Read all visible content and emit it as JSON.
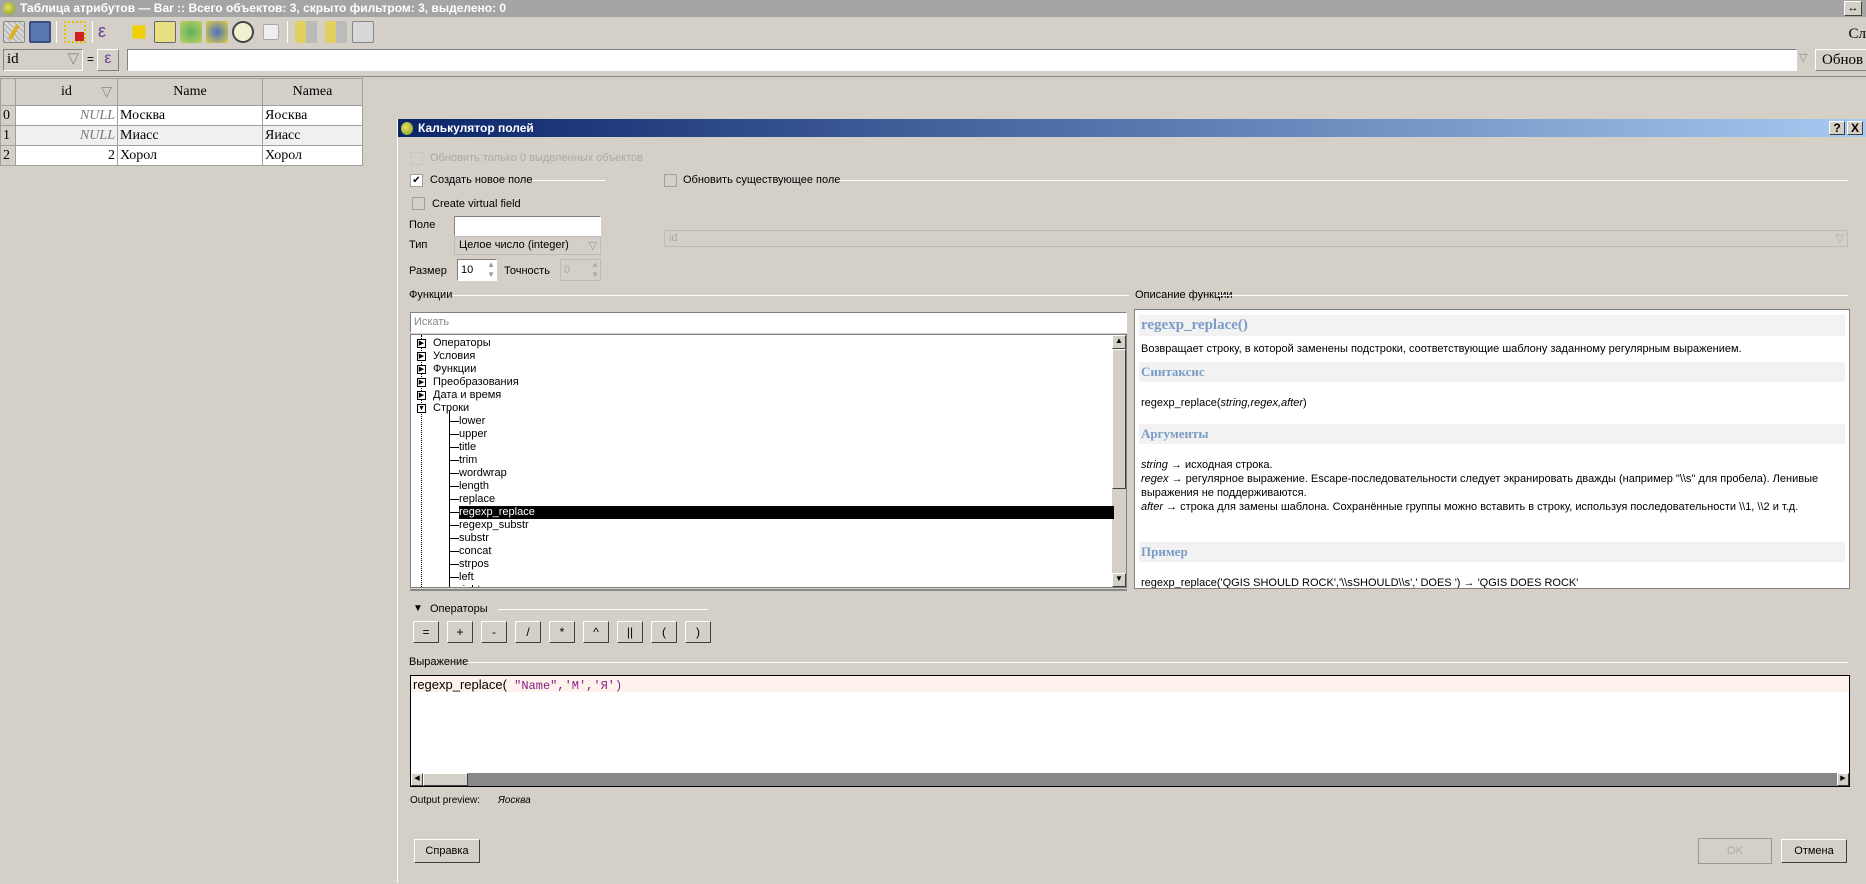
{
  "window": {
    "title": "Таблица атрибутов — Bar :: Всего объектов: 3, скрыто фильтром: 3, выделено: 0",
    "restore_icon": "↔",
    "corner_text": "Сл"
  },
  "toolbar": {
    "icons": [
      "edit-pencil-icon",
      "save-edits-icon",
      "delete-selected-icon",
      "select-by-expression-icon",
      "invert-selection-icon",
      "move-selection-to-top-icon",
      "pan-to-selected-icon",
      "zoom-to-selected-icon",
      "copy-rows-icon",
      "delete-column-icon",
      "new-column-icon",
      "field-calculator-icon"
    ]
  },
  "filter": {
    "field": "id",
    "equals": "=",
    "epsilon": "ε",
    "value": "",
    "update_button": "Обнов"
  },
  "table": {
    "columns": [
      "id",
      "Name",
      "Namea"
    ],
    "rows": [
      {
        "n": "0",
        "id": "NULL",
        "name": "Москва",
        "namea": "Яосква"
      },
      {
        "n": "1",
        "id": "NULL",
        "name": "Миасс",
        "namea": "Яиасс"
      },
      {
        "n": "2",
        "id": "2",
        "name": "Хорол",
        "namea": "Хорол"
      }
    ]
  },
  "dialog": {
    "title": "Калькулятор полей",
    "help_icon": "?",
    "close_icon": "X",
    "update_selected": "Обновить только 0 выделенных объектов",
    "create_new": "Создать новое поле",
    "create_new_checked": true,
    "update_existing": "Обновить существующее поле",
    "virtual": "Create virtual field",
    "field_label": "Поле",
    "field_value": "",
    "type_label": "Тип",
    "type_value": "Целое число (integer)",
    "size_label": "Размер",
    "size_value": "10",
    "precision_label": "Точность",
    "precision_value": "0",
    "existing_field": "id",
    "functions_label": "Функции",
    "search_placeholder": "Искать",
    "groups": [
      "Операторы",
      "Условия",
      "Функции",
      "Преобразования",
      "Дата и время",
      "Строки"
    ],
    "string_functions": [
      "lower",
      "upper",
      "title",
      "trim",
      "wordwrap",
      "length",
      "replace",
      "regexp_replace",
      "regexp_substr",
      "substr",
      "concat",
      "strpos",
      "left",
      "right"
    ],
    "selected_function": "regexp_replace",
    "desc_label": "Описание функции",
    "desc": {
      "title": "regexp_replace()",
      "summary": "Возвращает строку, в которой заменены подстроки, соответствующие шаблону заданному регулярным выражением.",
      "syntax_h": "Синтаксис",
      "syntax_fn": "regexp_replace(",
      "syntax_args": "string,regex,after",
      "syntax_end": ")",
      "args_h": "Аргументы",
      "arg1_name": "string",
      "arg1_text": " → исходная строка.",
      "arg2_name": "regex",
      "arg2_text": " → регулярное выражение. Escape-последовательности следует экранировать дважды (например \"\\\\s\" для пробела). Ленивые выражения не поддерживаются.",
      "arg3_name": "after",
      "arg3_text": " → строка для замены шаблона. Сохранённые группы можно вставить в строку, используя последовательности \\\\1, \\\\2 и т.д.",
      "example_h": "Пример",
      "example": "regexp_replace('QGIS SHOULD ROCK','\\\\sSHOULD\\\\s',' DOES ') → 'QGIS DOES ROCK'"
    },
    "operators_label": "Операторы",
    "operators": [
      "=",
      "+",
      "-",
      "/",
      "*",
      "^",
      "||",
      "(",
      ")"
    ],
    "expression_label": "Выражение",
    "expression": {
      "fn": "regexp_replace(",
      "field": " \"Name\"",
      "rest": ",'M','Я')"
    },
    "preview_label": "Output preview:",
    "preview_value": "Яосква",
    "help_button": "Справка",
    "ok_button": "OK",
    "cancel_button": "Отмена"
  }
}
